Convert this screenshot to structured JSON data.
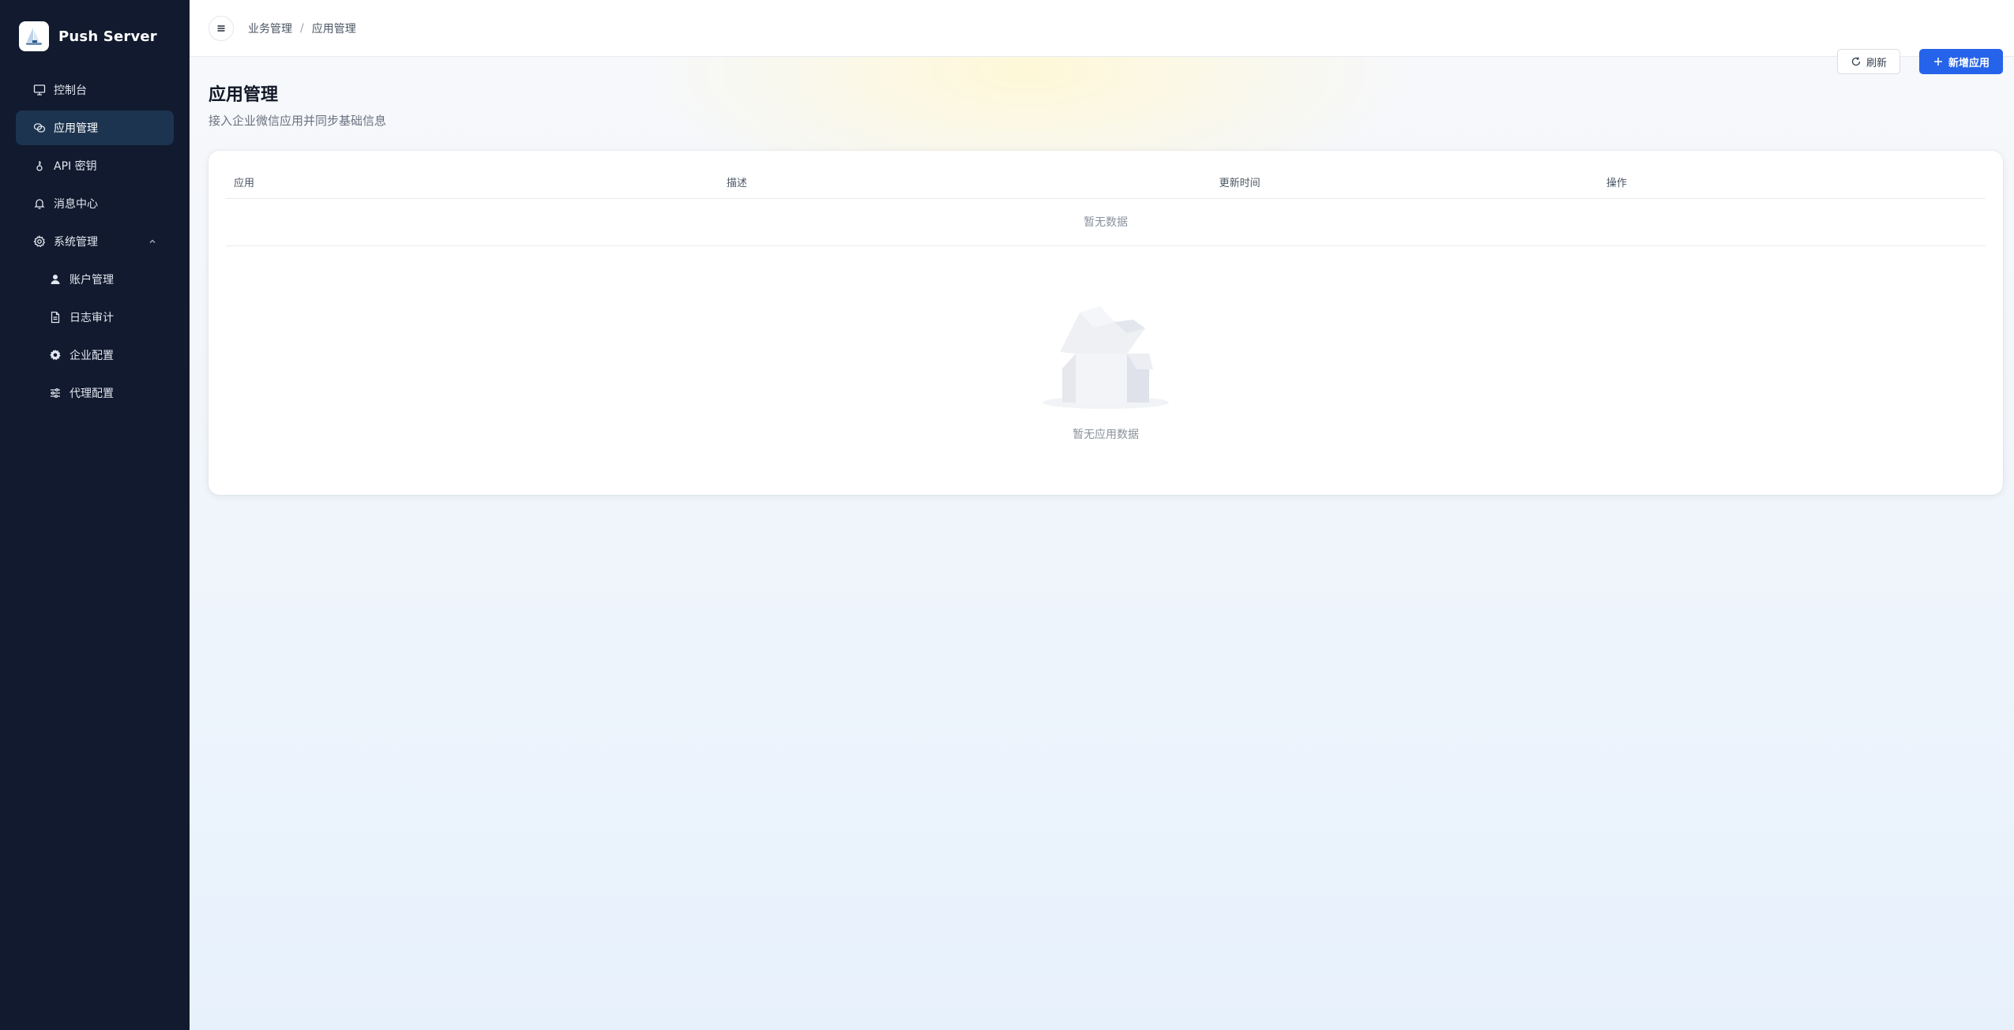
{
  "app": {
    "name": "Push Server"
  },
  "sidebar": {
    "items": [
      {
        "label": "控制台",
        "icon": "monitor-icon",
        "active": false
      },
      {
        "label": "应用管理",
        "icon": "apps-icon",
        "active": true
      },
      {
        "label": "API 密钥",
        "icon": "key-icon",
        "active": false
      },
      {
        "label": "消息中心",
        "icon": "bell-icon",
        "active": false
      },
      {
        "label": "系统管理",
        "icon": "gear-icon",
        "active": false,
        "expanded": true
      }
    ],
    "sub_items": [
      {
        "label": "账户管理",
        "icon": "user-icon"
      },
      {
        "label": "日志审计",
        "icon": "file-icon"
      },
      {
        "label": "企业配置",
        "icon": "cog-icon"
      },
      {
        "label": "代理配置",
        "icon": "sliders-icon"
      }
    ]
  },
  "topbar": {
    "breadcrumb": [
      "业务管理",
      "应用管理"
    ],
    "separator": "/"
  },
  "page": {
    "title": "应用管理",
    "subtitle": "接入企业微信应用并同步基础信息",
    "refresh_label": "刷新",
    "add_label": "新增应用"
  },
  "table": {
    "columns": [
      "应用",
      "描述",
      "更新时间",
      "操作"
    ],
    "no_data_text": "暂无数据"
  },
  "empty_state": {
    "text": "暂无应用数据"
  },
  "colors": {
    "sidebar_bg": "#111a2e",
    "active_item_bg": "#1d3450",
    "primary": "#2563eb"
  }
}
